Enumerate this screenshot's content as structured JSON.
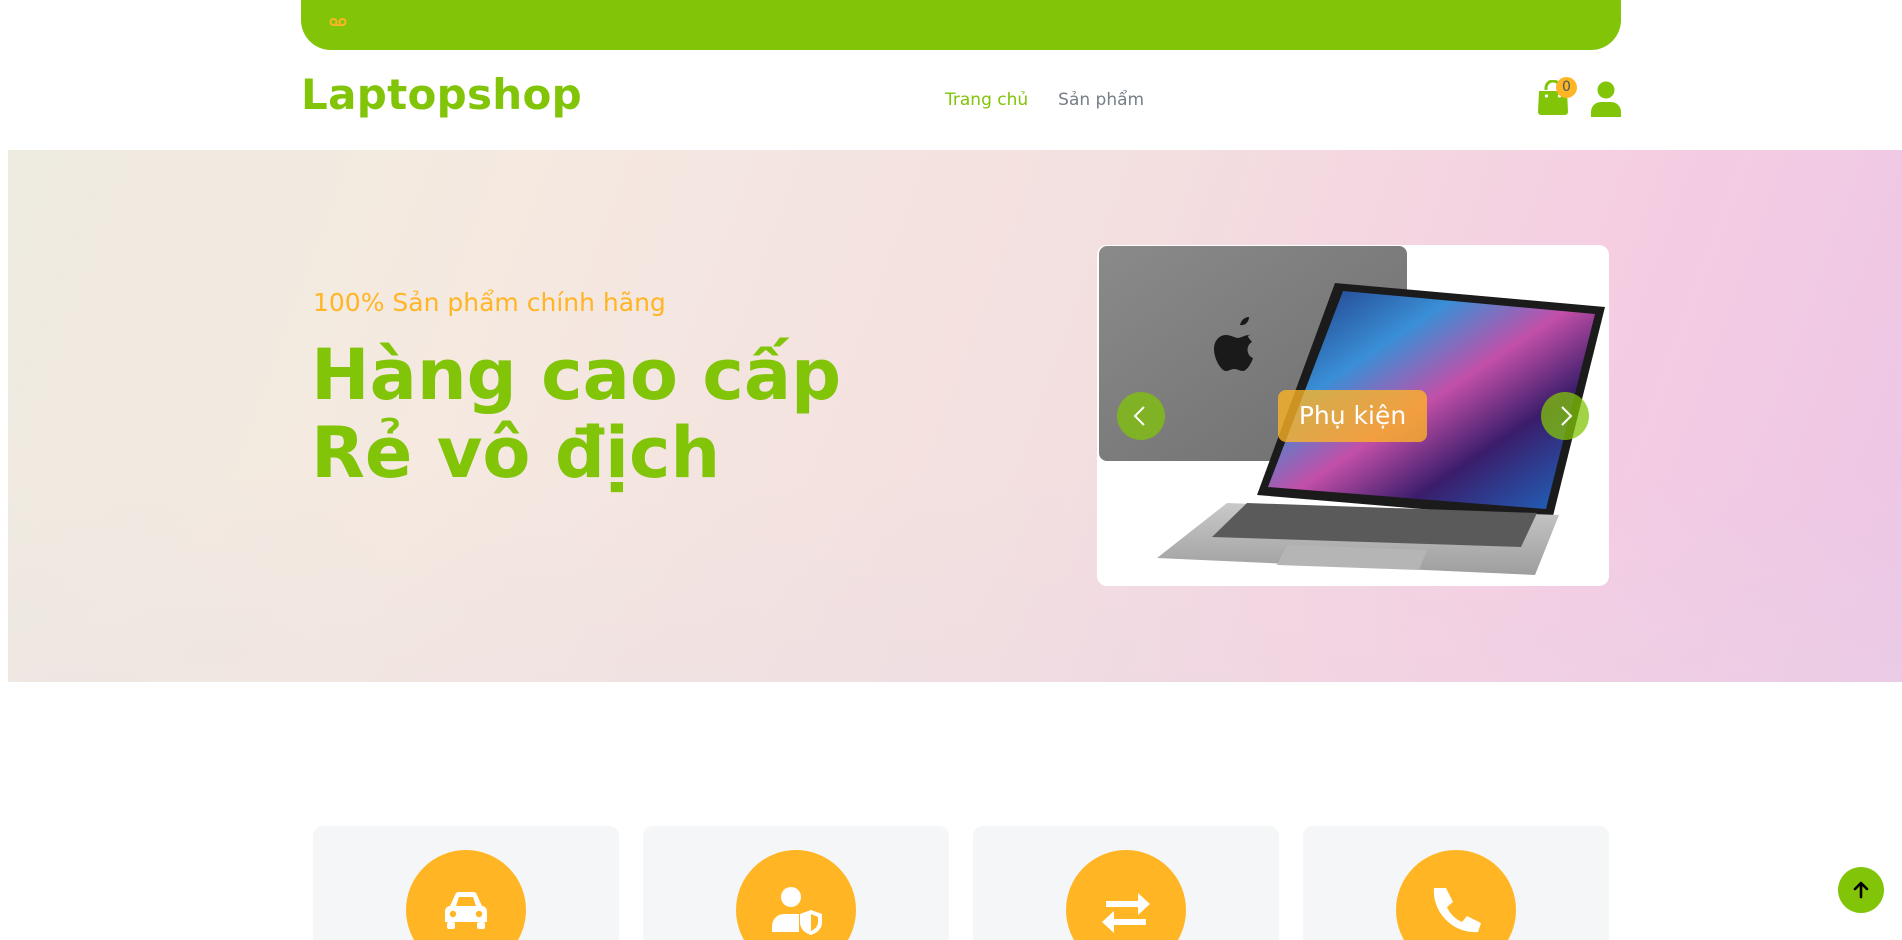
{
  "topbar": {
    "icon": "voicemail-icon",
    "color": "#81c408"
  },
  "header": {
    "brand": "Laptopshop",
    "nav": [
      {
        "label": "Trang chủ",
        "active": true
      },
      {
        "label": "Sản phẩm",
        "active": false
      }
    ],
    "cart_count": "0",
    "icons": [
      "shopping-bag-icon",
      "user-icon"
    ]
  },
  "hero": {
    "subtitle": "100% Sản phẩm chính hãng",
    "title_line1": "Hàng cao cấp",
    "title_line2": "Rẻ vô địch",
    "carousel": {
      "caption": "Phụ kiện",
      "prev_icon": "chevron-left-icon",
      "next_icon": "chevron-right-icon"
    }
  },
  "features": [
    {
      "icon": "car-icon"
    },
    {
      "icon": "user-shield-icon"
    },
    {
      "icon": "exchange-icon"
    },
    {
      "icon": "phone-icon"
    }
  ],
  "colors": {
    "primary": "#81c408",
    "secondary": "#ffb524",
    "card_bg": "#f4f6f8"
  }
}
